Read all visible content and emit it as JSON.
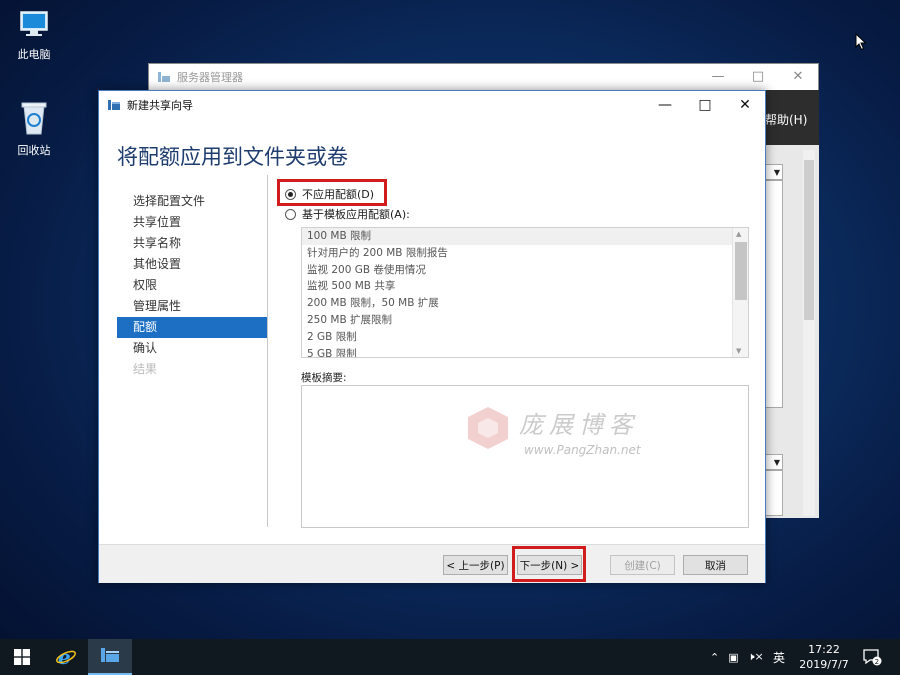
{
  "desktop": {
    "icons": [
      {
        "label": "此电脑",
        "icon": "computer-icon"
      },
      {
        "label": "回收站",
        "icon": "recycle-bin-icon"
      }
    ]
  },
  "server_manager": {
    "title": "服务器管理器",
    "menu_help": "帮助(H)"
  },
  "wizard": {
    "title": "新建共享向导",
    "page_title": "将配额应用到文件夹或卷",
    "nav": [
      {
        "label": "选择配置文件",
        "state": "normal"
      },
      {
        "label": "共享位置",
        "state": "normal"
      },
      {
        "label": "共享名称",
        "state": "normal"
      },
      {
        "label": "其他设置",
        "state": "normal"
      },
      {
        "label": "权限",
        "state": "normal"
      },
      {
        "label": "管理属性",
        "state": "normal"
      },
      {
        "label": "配额",
        "state": "active"
      },
      {
        "label": "确认",
        "state": "normal"
      },
      {
        "label": "结果",
        "state": "disabled"
      }
    ],
    "options": {
      "no_quota": "不应用配额(D)",
      "template_quota": "基于模板应用配额(A):"
    },
    "templates": [
      "100 MB 限制",
      "针对用户的 200 MB 限制报告",
      "监视 200 GB 卷使用情况",
      "监视 500 MB 共享",
      "200 MB 限制，50 MB 扩展",
      "250 MB 扩展限制",
      "2 GB 限制",
      "5 GB 限制"
    ],
    "summary_label": "模板摘要:",
    "buttons": {
      "prev": "< 上一步(P)",
      "next": "下一步(N) >",
      "create": "创建(C)",
      "cancel": "取消"
    }
  },
  "watermark": {
    "cn": "庞展博客",
    "en": "www.PangZhan.net"
  },
  "taskbar": {
    "ime": "英",
    "time": "17:22",
    "date": "2019/7/7",
    "notification_count": "2"
  },
  "colors": {
    "accent": "#1c6fc3",
    "highlight": "#d01c1c",
    "title_text": "#1e3c6e"
  }
}
